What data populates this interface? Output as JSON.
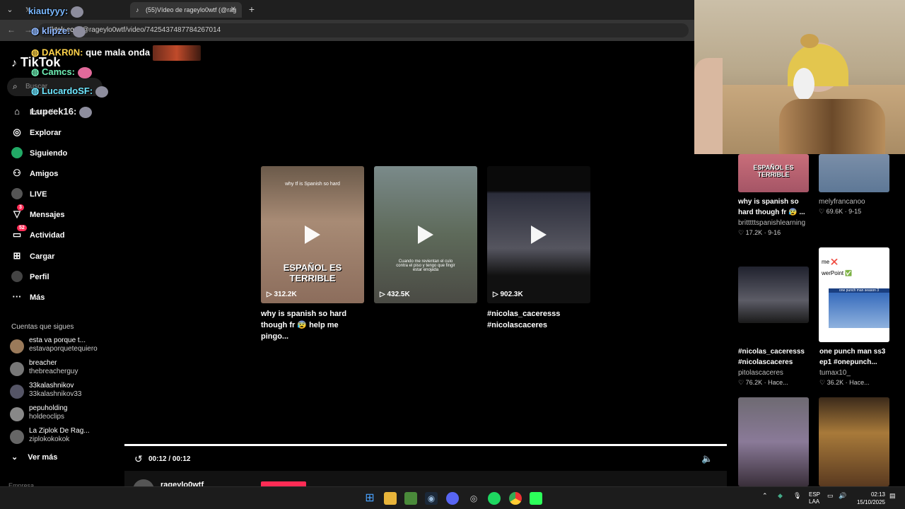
{
  "browser": {
    "tabs": [
      {
        "label": "",
        "active": false
      },
      {
        "label": "(55)Vídeo de rageylo0wtf (@rag",
        "active": true
      }
    ],
    "url_prefix": "/@rageylo0wtf/video/7425437487784267014",
    "url_host": "tiktok.com"
  },
  "sidebar": {
    "logo": "TikTok",
    "search_placeholder": "Buscar",
    "nav": [
      {
        "label": "Para ti",
        "icon": "home-icon"
      },
      {
        "label": "Explorar",
        "icon": "compass-icon"
      },
      {
        "label": "Siguiendo",
        "icon": "following-icon"
      },
      {
        "label": "Amigos",
        "icon": "friends-icon"
      },
      {
        "label": "LIVE",
        "icon": "live-icon"
      },
      {
        "label": "Mensajes",
        "icon": "messages-icon",
        "badge": "3"
      },
      {
        "label": "Actividad",
        "icon": "activity-icon",
        "badge": "52"
      },
      {
        "label": "Cargar",
        "icon": "upload-icon"
      },
      {
        "label": "Perfil",
        "icon": "profile-icon"
      },
      {
        "label": "Más",
        "icon": "more-icon"
      }
    ],
    "following_title": "Cuentas que sigues",
    "following": [
      {
        "name": "esta va porque t...",
        "handle": "estavaporquetequiero"
      },
      {
        "name": "breacher",
        "handle": "thebreacherguy"
      },
      {
        "name": "33kalashnikov",
        "handle": "33kalashnikov33"
      },
      {
        "name": "pepuholding",
        "handle": "holdeoclips"
      },
      {
        "name": "La Ziplok De Rag...",
        "handle": "ziplokokokok"
      }
    ],
    "see_more": "Ver más",
    "footer": "Empresa"
  },
  "chat": [
    {
      "user": "kiautyyy:",
      "msg": ""
    },
    {
      "user": "klipze:",
      "msg": ""
    },
    {
      "user": "DAKR0N:",
      "msg": "que mala onda"
    },
    {
      "user": "Camcs:",
      "msg": ""
    },
    {
      "user": "LucardoSF:",
      "msg": ""
    },
    {
      "user": "Lupeek16:",
      "msg": ""
    }
  ],
  "end_grid": [
    {
      "title": "why is spanish so hard though fr 😰 help me pingo...",
      "views": "312.2K",
      "overlay": "ESPAÑOL ES TERRIBLE",
      "caption": "why tf is Spanish so hard"
    },
    {
      "title": "",
      "views": "432.5K",
      "overlay": "",
      "caption": "Cuando me revientan el culo contra el piso y tengo que fingir estar enojada"
    },
    {
      "title": "#nicolas_caceresss #nicolascaceres",
      "views": "902.3K",
      "overlay": "",
      "caption": ""
    }
  ],
  "player": {
    "time": "00:12 / 00:12",
    "author": "rageylo0wtf"
  },
  "related": [
    {
      "title1": "why is spanish so",
      "title2": "hard though fr 😰 ...",
      "user": "britttttspanishlearning",
      "likes": "17.2K",
      "date": "9-16",
      "overlay": "ESPAÑOL ES TERRIBLE"
    },
    {
      "title1": "",
      "title2": "",
      "user": "melyfrancanoo",
      "likes": "69.6K",
      "date": "9-15",
      "overlay": ""
    },
    {
      "title1": "#nicolas_caceresss",
      "title2": "#nicolascaceres",
      "user": "pitolascaceres",
      "likes": "76.2K",
      "date": "Hace...",
      "overlay": ""
    },
    {
      "title1": "one punch man ss3",
      "title2": "ep1 #onepunch...",
      "user": "tumax10_",
      "likes": "36.2K",
      "date": "Hace...",
      "overlay": "one punch man season 3",
      "extra1": "me ❌",
      "extra2": "werPoint ✅"
    },
    {
      "title1": "",
      "title2": "",
      "user": "",
      "likes": "",
      "date": "",
      "overlay": ""
    },
    {
      "title1": "",
      "title2": "",
      "user": "",
      "likes": "",
      "date": "",
      "overlay": ""
    }
  ],
  "taskbar": {
    "lang1": "ESP",
    "lang2": "LAA",
    "time": "02:13",
    "date": "15/10/2025"
  },
  "colors": {
    "accent": "#fe2c55",
    "badge": "#fe2c55"
  }
}
